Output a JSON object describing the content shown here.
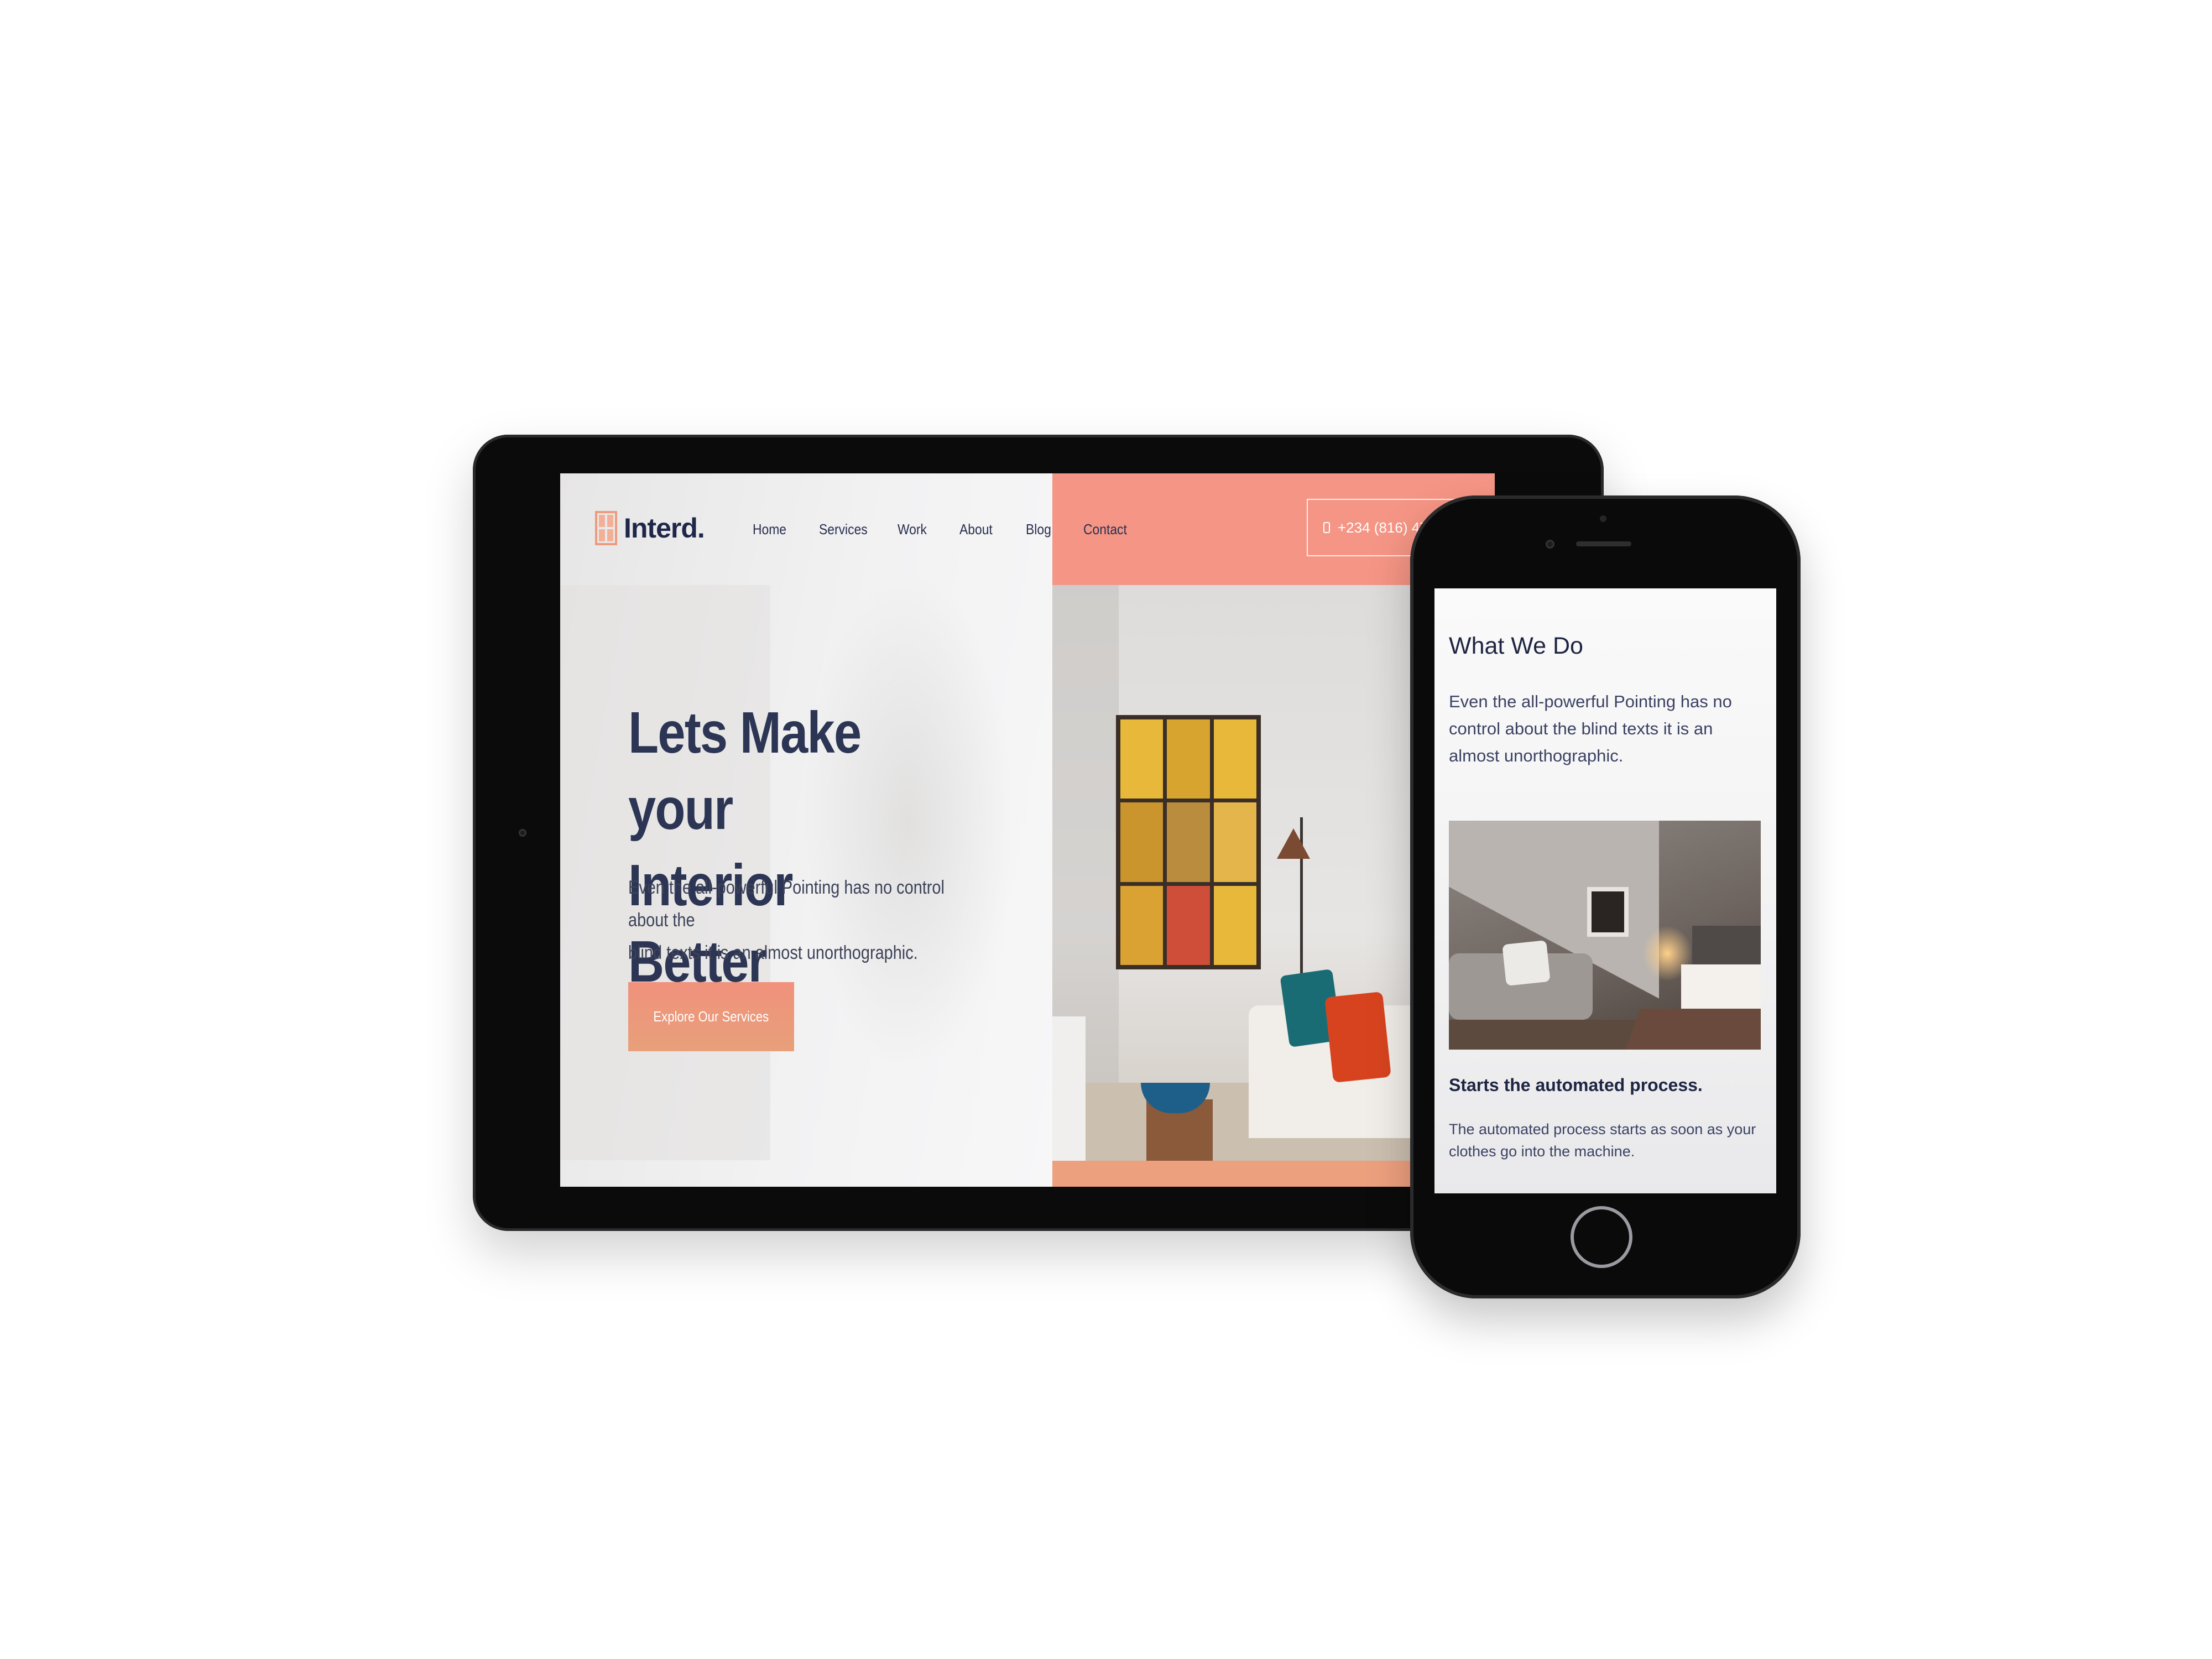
{
  "tablet": {
    "logo_text": "Interd.",
    "nav": [
      "Home",
      "Services",
      "Work",
      "About",
      "Blog",
      "Contact"
    ],
    "phone_number": "+234 (816) 47",
    "hero_title_line1": "Lets Make your",
    "hero_title_line2": "Interior Better",
    "hero_text_line1": "Even the all-powerful Pointing has no control about the",
    "hero_text_line2": "blind texts it is an almost unorthographic.",
    "hero_button": "Explore Our Services"
  },
  "phone": {
    "section_title": "What We Do",
    "section_text": "Even the all-powerful Pointing has no control about the blind texts it is an almost unorthographic.",
    "feature_title": "Starts the automated process.",
    "feature_text": "The automated process starts as soon as your clothes go into the machine."
  },
  "colors": {
    "accent": "#f28c7a",
    "dark_text": "#2c3554",
    "button": "#ee9780"
  },
  "icons": {
    "logo": "window-grid-icon",
    "phone": "phone-icon"
  }
}
